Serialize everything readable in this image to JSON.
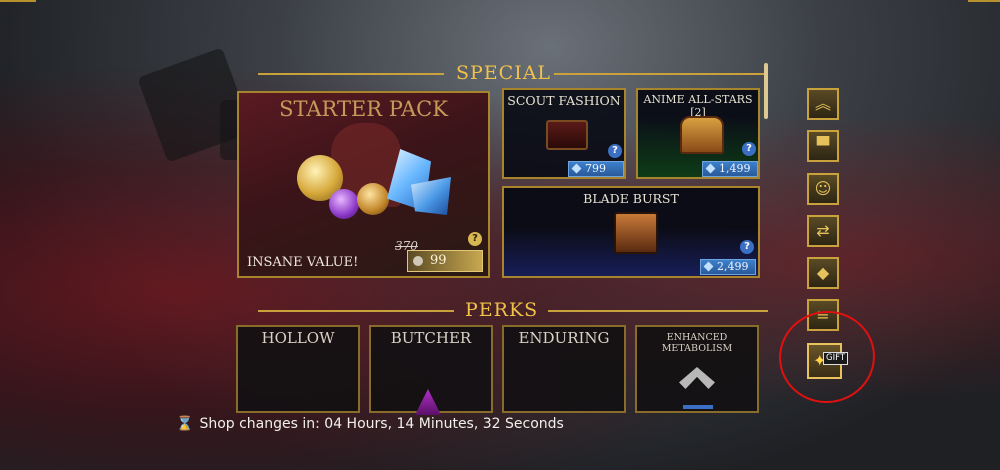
{
  "sections": {
    "special": "SPECIAL",
    "perks": "PERKS"
  },
  "starter_pack": {
    "title": "STARTER PACK",
    "tagline": "INSANE VALUE!",
    "old_price": "370",
    "price": "99",
    "help": "?"
  },
  "shop_items": [
    {
      "title": "SCOUT FASHION",
      "price": "799",
      "help": "?"
    },
    {
      "title": "ANIME ALL-STARS [2]",
      "price": "1,499",
      "help": "?"
    },
    {
      "title": "BLADE BURST",
      "price": "2,499",
      "help": "?"
    }
  ],
  "perks": [
    {
      "title": "HOLLOW"
    },
    {
      "title": "BUTCHER"
    },
    {
      "title": "ENDURING"
    },
    {
      "title": "ENHANCED METABOLISM"
    }
  ],
  "side_buttons": [
    {
      "icon": "rank-chevron-icon",
      "glyph": "︽"
    },
    {
      "icon": "top-hat-icon",
      "glyph": "▀"
    },
    {
      "icon": "emote-icon",
      "glyph": "☺"
    },
    {
      "icon": "refresh-icon",
      "glyph": "⇄"
    },
    {
      "icon": "diamond-icon",
      "glyph": "◆"
    },
    {
      "icon": "coin-stack-icon",
      "glyph": "≡"
    },
    {
      "icon": "gift-icon",
      "glyph": "✦"
    }
  ],
  "gift_tooltip": "GIFT",
  "timer": {
    "icon": "hourglass-icon",
    "glyph": "⌛",
    "text": "Shop changes in: 04 Hours, 14 Minutes, 32 Seconds"
  },
  "colors": {
    "gold": "#c9a23c",
    "title_gold": "#f0c24a",
    "price_blue": "#3c80cc",
    "annotation_red": "#e01010"
  }
}
